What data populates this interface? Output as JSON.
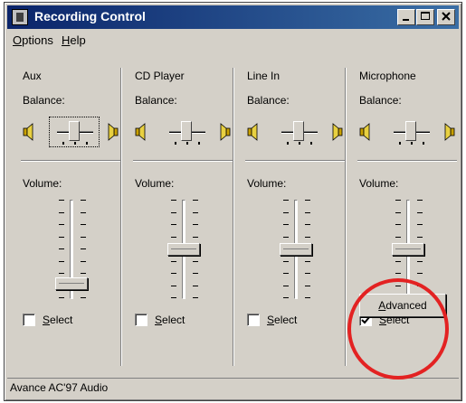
{
  "window": {
    "title": "Recording Control",
    "menu": [
      {
        "underline": "O",
        "rest": "ptions"
      },
      {
        "underline": "H",
        "rest": "elp"
      }
    ]
  },
  "channels": [
    {
      "name": "Aux",
      "balance_label": "Balance:",
      "volume_label": "Volume:",
      "volume_level": 0.1,
      "balance": 0.5,
      "select": {
        "checked": false,
        "underline": "S",
        "rest": "elect"
      }
    },
    {
      "name": "CD Player",
      "balance_label": "Balance:",
      "volume_label": "Volume:",
      "volume_level": 0.5,
      "balance": 0.5,
      "select": {
        "checked": false,
        "underline": "S",
        "rest": "elect"
      }
    },
    {
      "name": "Line In",
      "balance_label": "Balance:",
      "volume_label": "Volume:",
      "volume_level": 0.5,
      "balance": 0.5,
      "select": {
        "checked": false,
        "underline": "S",
        "rest": "elect"
      }
    },
    {
      "name": "Microphone",
      "balance_label": "Balance:",
      "volume_label": "Volume:",
      "volume_level": 0.5,
      "balance": 0.5,
      "select": {
        "checked": true,
        "underline": "S",
        "rest": "elect"
      }
    }
  ],
  "advanced_button": {
    "underline": "A",
    "rest": "dvanced"
  },
  "status": "Avance AC'97 Audio",
  "colors": {
    "titlebar_start": "#0a246a",
    "titlebar_end": "#3a6ea5",
    "face": "#d4d0c8",
    "annotation": "#e32222"
  }
}
